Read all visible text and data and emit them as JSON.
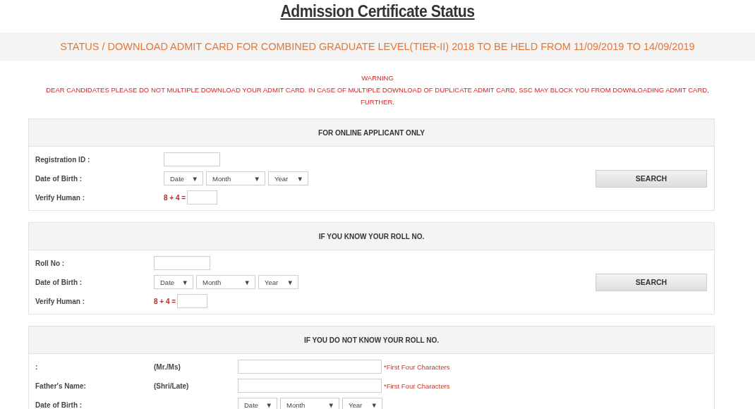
{
  "title": "Admission Certificate Status",
  "banner": "STATUS / DOWNLOAD ADMIT CARD FOR COMBINED GRADUATE LEVEL(TIER-II) 2018 TO BE HELD FROM 11/09/2019 TO 14/09/2019",
  "warning": {
    "heading": "WARNING",
    "text": "DEAR CANDIDATES PLEASE DO NOT MULTIPLE DOWNLOAD YOUR ADMIT CARD. IN CASE OF MULTIPLE DOWNLOAD OF DUPLICATE ADMIT CARD, SSC MAY BLOCK YOU FROM DOWNLOADING ADMIT CARD, FURTHER."
  },
  "panels": [
    {
      "heading": "FOR ONLINE APPLICANT ONLY",
      "button": "SEARCH",
      "rows": [
        {
          "kind": "text",
          "label": "Registration ID :"
        },
        {
          "kind": "date",
          "label": "Date of Birth :",
          "selects": [
            {
              "value": "Date",
              "arrow": "▼"
            },
            {
              "value": "Month",
              "arrow": "▼"
            },
            {
              "value": "Year",
              "arrow": "▼"
            }
          ]
        },
        {
          "kind": "captcha",
          "label": "Verify Human :",
          "question": "8 + 4 ="
        }
      ]
    },
    {
      "heading": "IF YOU KNOW YOUR ROLL NO.",
      "button": "SEARCH",
      "rows": [
        {
          "kind": "text",
          "label": "Roll No :"
        },
        {
          "kind": "date",
          "label": "Date of Birth :",
          "selects": [
            {
              "value": "Date",
              "arrow": "▼"
            },
            {
              "value": "Month",
              "arrow": "▼"
            },
            {
              "value": "Year",
              "arrow": "▼"
            }
          ]
        },
        {
          "kind": "captcha",
          "label": "Verify Human :",
          "question": "8 + 4 ="
        }
      ]
    },
    {
      "heading": "IF YOU DO NOT KNOW YOUR ROLL NO.",
      "rows": [
        {
          "kind": "name",
          "label": ":",
          "prefix": "(Mr./Ms)",
          "hint": "*First Four Characters"
        },
        {
          "kind": "name",
          "label": "Father's Name:",
          "prefix": "(Shri/Late)",
          "hint": "*First Four Characters"
        },
        {
          "kind": "date2",
          "label": "Date of Birth :",
          "selects": [
            {
              "value": "Date",
              "arrow": "▼"
            },
            {
              "value": "Month",
              "arrow": "▼"
            },
            {
              "value": "Year",
              "arrow": "▼"
            }
          ]
        }
      ]
    }
  ]
}
